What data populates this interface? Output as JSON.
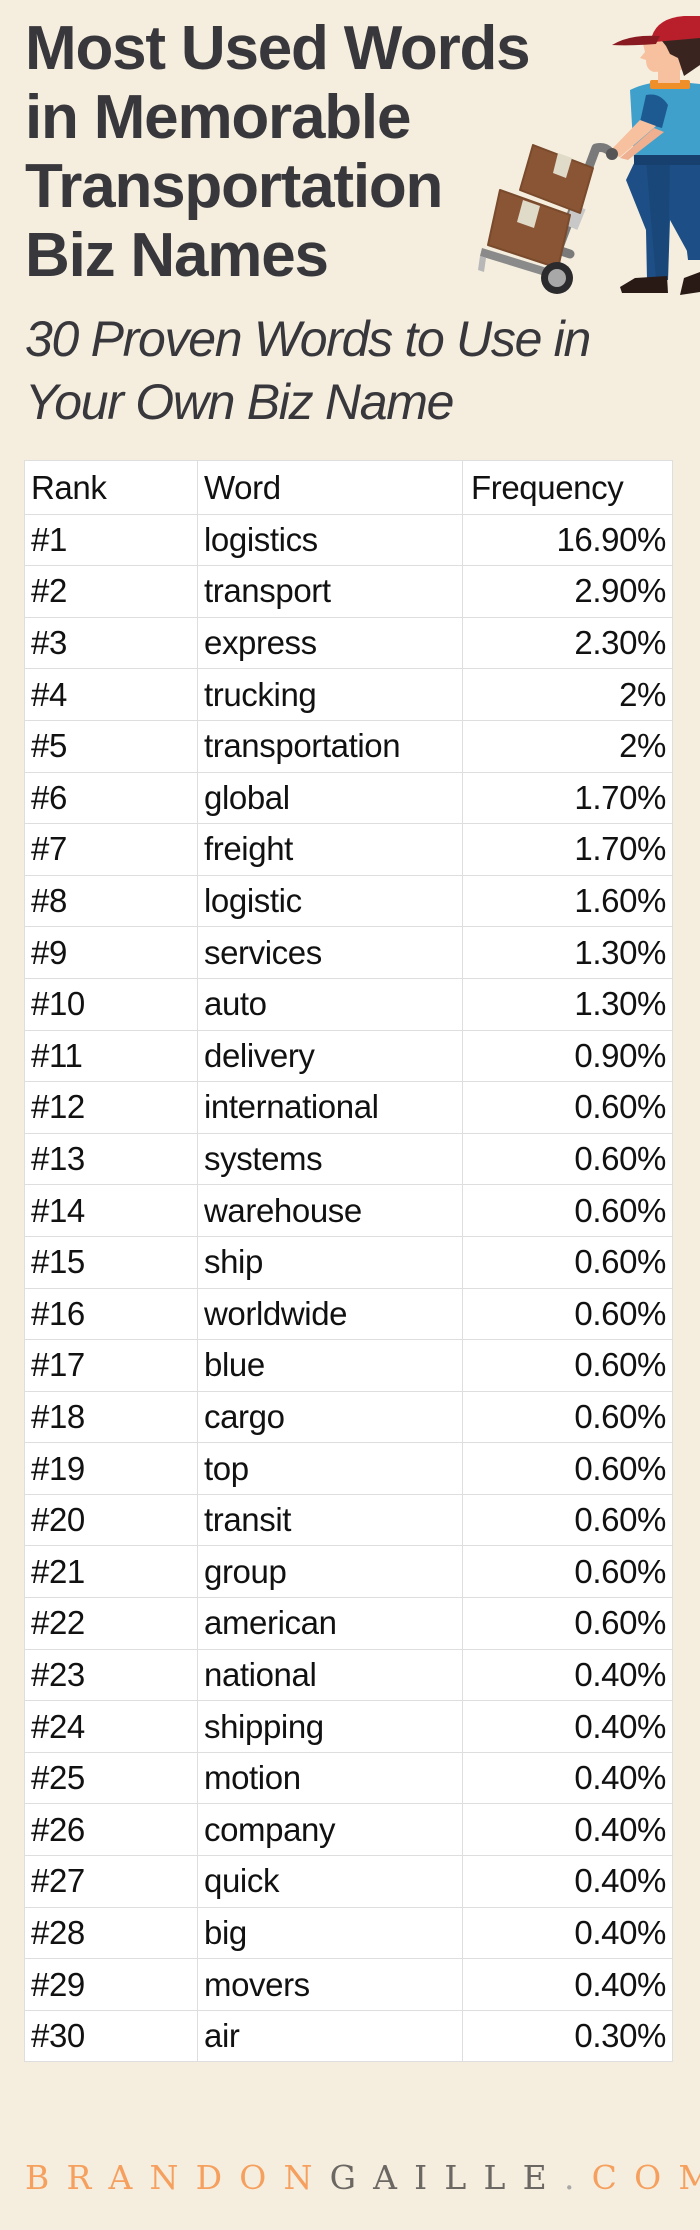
{
  "header": {
    "title_lines": [
      "Most Used Words",
      "in Memorable",
      "Transportation",
      "Biz Names"
    ],
    "subtitle_lines": [
      "30 Proven Words to Use in",
      "Your Own Biz Name"
    ],
    "illustration": "delivery-man-with-hand-truck-icon"
  },
  "table": {
    "columns": [
      "Rank",
      "Word",
      "Frequency"
    ],
    "rows": [
      {
        "rank": "#1",
        "word": "logistics",
        "frequency": "16.90%"
      },
      {
        "rank": "#2",
        "word": "transport",
        "frequency": "2.90%"
      },
      {
        "rank": "#3",
        "word": "express",
        "frequency": "2.30%"
      },
      {
        "rank": "#4",
        "word": "trucking",
        "frequency": "2%"
      },
      {
        "rank": "#5",
        "word": "transportation",
        "frequency": "2%"
      },
      {
        "rank": "#6",
        "word": "global",
        "frequency": "1.70%"
      },
      {
        "rank": "#7",
        "word": "freight",
        "frequency": "1.70%"
      },
      {
        "rank": "#8",
        "word": "logistic",
        "frequency": "1.60%"
      },
      {
        "rank": "#9",
        "word": "services",
        "frequency": "1.30%"
      },
      {
        "rank": "#10",
        "word": "auto",
        "frequency": "1.30%"
      },
      {
        "rank": "#11",
        "word": "delivery",
        "frequency": "0.90%"
      },
      {
        "rank": "#12",
        "word": "international",
        "frequency": "0.60%"
      },
      {
        "rank": "#13",
        "word": "systems",
        "frequency": "0.60%"
      },
      {
        "rank": "#14",
        "word": "warehouse",
        "frequency": "0.60%"
      },
      {
        "rank": "#15",
        "word": "ship",
        "frequency": "0.60%"
      },
      {
        "rank": "#16",
        "word": "worldwide",
        "frequency": "0.60%"
      },
      {
        "rank": "#17",
        "word": "blue",
        "frequency": "0.60%"
      },
      {
        "rank": "#18",
        "word": "cargo",
        "frequency": "0.60%"
      },
      {
        "rank": "#19",
        "word": "top",
        "frequency": "0.60%"
      },
      {
        "rank": "#20",
        "word": "transit",
        "frequency": "0.60%"
      },
      {
        "rank": "#21",
        "word": "group",
        "frequency": "0.60%"
      },
      {
        "rank": "#22",
        "word": "american",
        "frequency": "0.60%"
      },
      {
        "rank": "#23",
        "word": "national",
        "frequency": "0.40%"
      },
      {
        "rank": "#24",
        "word": "shipping",
        "frequency": "0.40%"
      },
      {
        "rank": "#25",
        "word": "motion",
        "frequency": "0.40%"
      },
      {
        "rank": "#26",
        "word": "company",
        "frequency": "0.40%"
      },
      {
        "rank": "#27",
        "word": "quick",
        "frequency": "0.40%"
      },
      {
        "rank": "#28",
        "word": "big",
        "frequency": "0.40%"
      },
      {
        "rank": "#29",
        "word": "movers",
        "frequency": "0.40%"
      },
      {
        "rank": "#30",
        "word": "air",
        "frequency": "0.30%"
      }
    ]
  },
  "footer": {
    "brand_part1": "BRANDON",
    "brand_part2": "GAILLE",
    "dot": ".",
    "tld": "COM"
  },
  "colors": {
    "background": "#f5eedf",
    "title_text": "#38373c",
    "brand_orange": "#f5a05e",
    "brand_gray": "#6b6762",
    "table_border": "#dedede"
  }
}
